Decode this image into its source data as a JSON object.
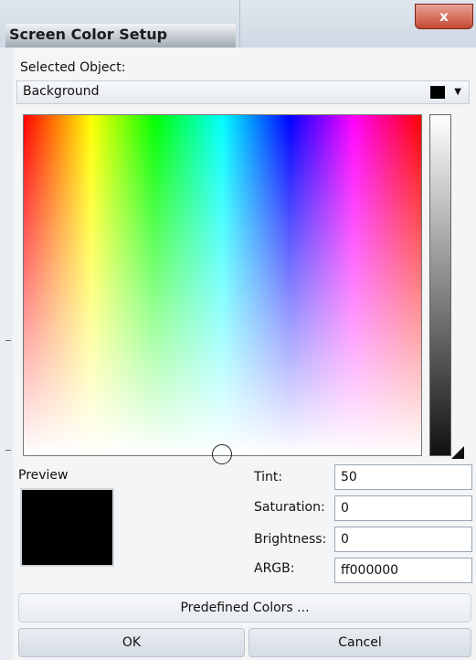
{
  "window": {
    "title": "Screen Color Setup",
    "close_label": "x"
  },
  "selected_object": {
    "label": "Selected Object:",
    "value": "Background",
    "swatch_color": "#000000"
  },
  "preview": {
    "label": "Preview",
    "color": "#000000"
  },
  "fields": {
    "tint": {
      "label": "Tint:",
      "value": "50"
    },
    "saturation": {
      "label": "Saturation:",
      "value": "0"
    },
    "brightness": {
      "label": "Brightness:",
      "value": "0"
    },
    "argb": {
      "label": "ARGB:",
      "value": "ff000000"
    }
  },
  "buttons": {
    "predefined": "Predefined Colors ...",
    "ok": "OK",
    "cancel": "Cancel"
  },
  "icons": {
    "dropdown": "chevron-down-icon",
    "close": "close-icon",
    "picker": "picker-circle-icon"
  }
}
